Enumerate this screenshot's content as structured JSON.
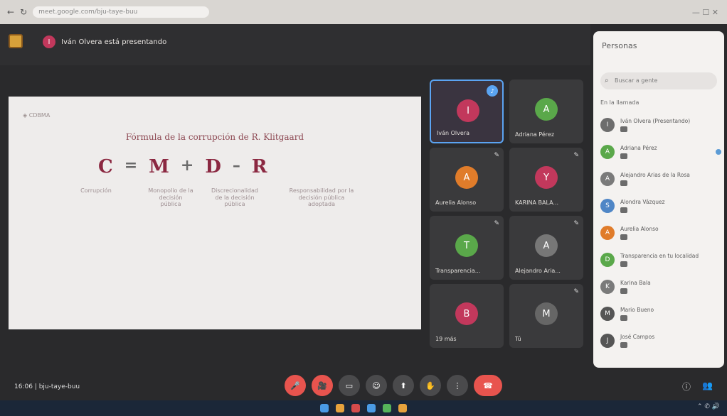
{
  "browser": {
    "url": "meet.google.com/bju-taye-buu",
    "controls": "— ☐ ✕"
  },
  "meeting": {
    "presenter_text": "Iván Olvera está presentando"
  },
  "slide": {
    "logo_text": "◈ CDBMA",
    "title": "Fórmula de la corrupción de R. Klitgaard",
    "formula": [
      "C",
      "=",
      "M",
      "+",
      "D",
      "–",
      "R"
    ],
    "columns": [
      {
        "text": "Corrupción"
      },
      {
        "text": "Monopolio de la decisión pública"
      },
      {
        "text": "Discrecionalidad de la decisión pública"
      },
      {
        "text": "Responsabilidad por la decisión pública adoptada"
      }
    ]
  },
  "participants": [
    {
      "name": "Iván Olvera",
      "initial": "I",
      "color": "#c2385c"
    },
    {
      "name": "Adriana Pérez",
      "initial": "A",
      "color": "#5aa84a"
    },
    {
      "name": "Aurelia Alonso",
      "initial": "A",
      "color": "#e07c2a"
    },
    {
      "name": "KARINA BALA...",
      "initial": "Y",
      "color": "#c2385c"
    },
    {
      "name": "Transparencia...",
      "initial": "T",
      "color": "#5aa84a"
    },
    {
      "name": "Alejandro Aria...",
      "initial": "A",
      "color": "#777"
    },
    {
      "name": "19 más",
      "initial": "B",
      "color": "#c2385c"
    },
    {
      "name": "Tú",
      "initial": "M",
      "color": "#666"
    }
  ],
  "people_panel": {
    "title": "Personas",
    "search_placeholder": "Buscar a gente",
    "section_label": "En la llamada",
    "people": [
      {
        "name": "Iván Olvera (Presentando)",
        "initial": "I",
        "color": "#6d6d6d"
      },
      {
        "name": "Adriana Pérez",
        "initial": "A",
        "color": "#5aa84a"
      },
      {
        "name": "Alejandro Arias de la Rosa",
        "initial": "A",
        "color": "#7a7a7a"
      },
      {
        "name": "Alondra Vázquez",
        "initial": "S",
        "color": "#4f86c6"
      },
      {
        "name": "Aurelia Alonso",
        "initial": "A",
        "color": "#e07c2a"
      },
      {
        "name": "Transparencia en tu localidad",
        "initial": "D",
        "color": "#5aa84a"
      },
      {
        "name": "Karina Bala",
        "initial": "K",
        "color": "#7a7a7a"
      },
      {
        "name": "Mario Bueno",
        "initial": "M",
        "color": "#555"
      },
      {
        "name": "José Campos",
        "initial": "J",
        "color": "#555"
      }
    ]
  },
  "bottom": {
    "meeting_code": "16:06 | bju-taye-buu",
    "controls": [
      "🎤",
      "🎥",
      "▭",
      "☺",
      "⬆",
      "✋",
      "⋮",
      "☎"
    ]
  }
}
